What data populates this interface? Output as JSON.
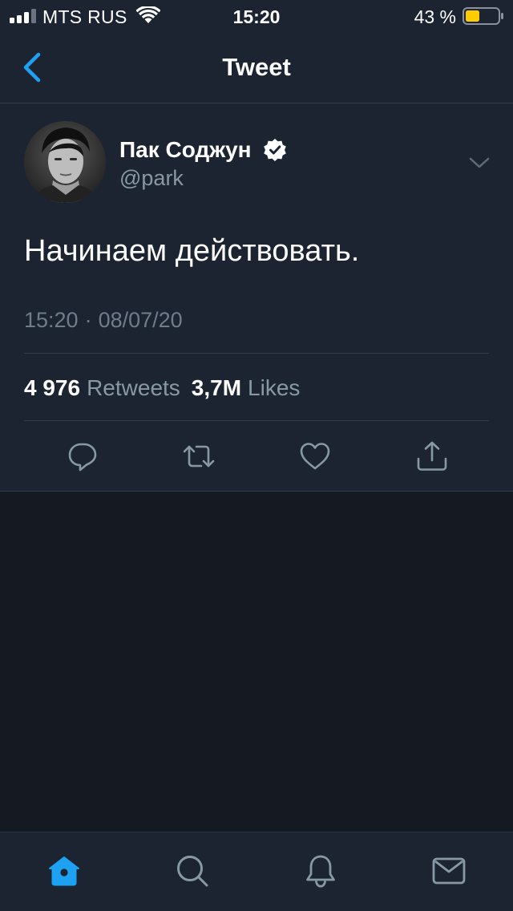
{
  "status_bar": {
    "carrier": "MTS RUS",
    "time": "15:20",
    "battery_percent": "43 %",
    "battery_level": 0.43,
    "icons": [
      "signal-bars",
      "wifi",
      "battery"
    ]
  },
  "nav": {
    "title": "Tweet",
    "back_icon": "chevron-left"
  },
  "tweet": {
    "author": {
      "display_name": "Пак Соджун",
      "handle": "@park",
      "verified": true
    },
    "text": "Начинаем действовать.",
    "time": "15:20",
    "separator": "·",
    "date": "08/07/20",
    "stats": {
      "retweets_count": "4 976",
      "retweets_label": "Retweets",
      "likes_count": "3,7M",
      "likes_label": "Likes"
    },
    "actions": [
      "reply",
      "retweet",
      "like",
      "share"
    ]
  },
  "tab_bar": {
    "tabs": [
      "home",
      "search",
      "notifications",
      "messages"
    ],
    "active": "home"
  },
  "colors": {
    "accent": "#1da1f2",
    "background": "#141922",
    "card": "#1c2431",
    "secondary_text": "#8899a6",
    "divider": "#323d4d",
    "battery_fill": "#ffcc00"
  }
}
